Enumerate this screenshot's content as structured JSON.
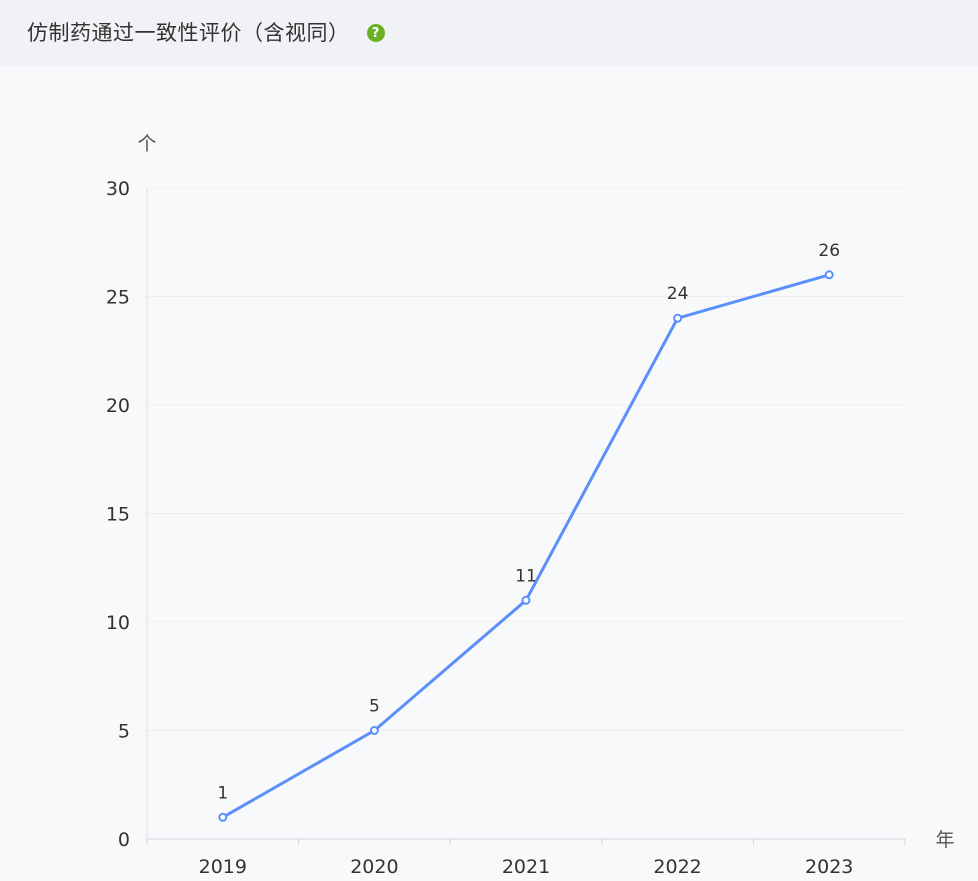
{
  "header": {
    "title": "仿制药通过一致性评价（含视同）",
    "help_icon": "question-circle-icon",
    "help_glyph": "?"
  },
  "colors": {
    "line": "#5b8ff9",
    "point_fill": "#ffffff",
    "help_icon": "#6ab023",
    "grid": "#eceef2"
  },
  "chart_data": {
    "type": "line",
    "categories": [
      "2019",
      "2020",
      "2021",
      "2022",
      "2023"
    ],
    "series": [
      {
        "values": [
          1,
          5,
          11,
          24,
          26
        ]
      }
    ],
    "xlabel": "年",
    "ylabel": "个",
    "ylim": [
      0,
      30
    ],
    "yticks": [
      0,
      5,
      10,
      15,
      20,
      25,
      30
    ],
    "data_labels": [
      "1",
      "5",
      "11",
      "24",
      "26"
    ],
    "grid": true,
    "legend": "none"
  }
}
